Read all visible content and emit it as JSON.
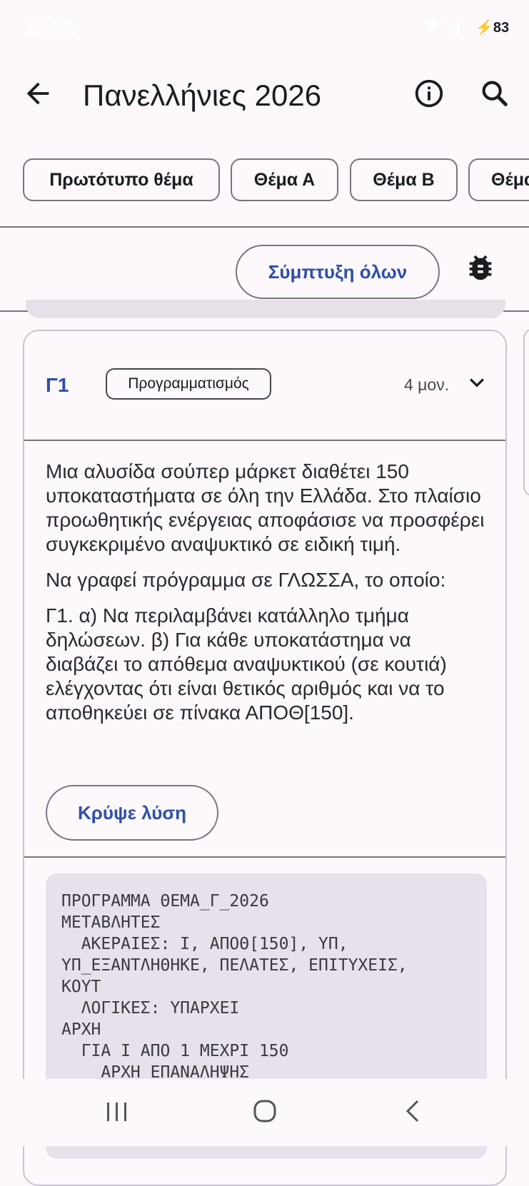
{
  "status": {
    "time": "12:57",
    "battery": "83"
  },
  "appbar": {
    "title": "Πανελλήνιες 2026"
  },
  "tabs": [
    {
      "label": "Πρωτότυπο θέμα"
    },
    {
      "label": "Θέμα Α"
    },
    {
      "label": "Θέμα Β"
    },
    {
      "label": "Θέμα"
    }
  ],
  "toolbar": {
    "collapse_all_label": "Σύμπτυξη όλων"
  },
  "card": {
    "id": "Γ1",
    "tag": "Προγραμματισμός",
    "duration": "4 μον.",
    "paragraphs": [
      "Μια αλυσίδα σούπερ μάρκετ διαθέτει 150 υποκαταστήματα σε όλη την Ελλάδα. Στο πλαίσιο προωθητικής ενέργειας αποφάσισε να προσφέρει συγκεκριμένο αναψυκτικό σε ειδική τιμή.",
      "Να γραφεί πρόγραμμα σε ΓΛΩΣΣΑ, το οποίο:",
      "Γ1. α) Να περιλαμβάνει κατάλληλο τμήμα δηλώσεων. β) Για κάθε υποκατάστημα να διαβάζει το απόθεμα αναψυκτικού (σε κουτιά) ελέγχοντας ότι είναι θετικός αριθμός και να το αποθηκεύει σε πίνακα ΑΠΟΘ[150]."
    ],
    "hide_solution_label": "Κρύψε λύση",
    "code": "ΠΡΟΓΡΑΜΜΑ ΘΕΜΑ_Γ_2026\nΜΕΤΑΒΛΗΤΕΣ\n  ΑΚΕΡΑΙΕΣ: Ι, ΑΠΟΘ[150], ΥΠ,\nΥΠ_ΕΞΑΝΤΛΗΘΗΚΕ, ΠΕΛΑΤΕΣ, ΕΠΙΤΥΧΕΙΣ,\nΚΟΥΤ\n  ΛΟΓΙΚΕΣ: ΥΠΑΡΧΕΙ\nΑΡΧΗ\n  ΓΙΑ Ι ΑΠΟ 1 ΜΕΧΡΙ 150\n    ΑΡΧΗ_ΕΠΑΝΑΛΗΨΗΣ"
  },
  "colors": {
    "accent": "#2e4ea8",
    "background": "#fcf8fc",
    "code_bg": "#e6e1ea"
  }
}
